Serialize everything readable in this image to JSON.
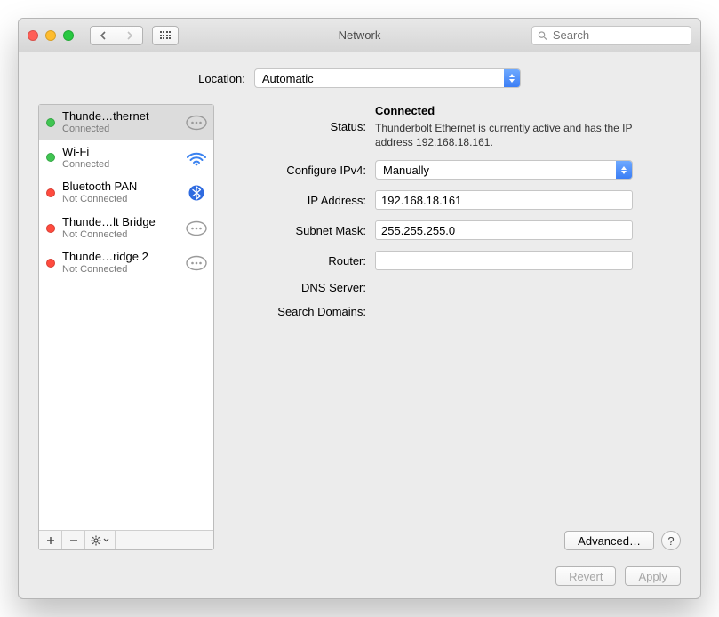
{
  "window": {
    "title": "Network",
    "search_placeholder": "Search"
  },
  "location": {
    "label": "Location:",
    "value": "Automatic"
  },
  "connections": [
    {
      "name": "Thunde…thernet",
      "status": "Connected",
      "dot": "green",
      "icon": "thunderbolt",
      "selected": true
    },
    {
      "name": "Wi-Fi",
      "status": "Connected",
      "dot": "green",
      "icon": "wifi",
      "selected": false
    },
    {
      "name": "Bluetooth PAN",
      "status": "Not Connected",
      "dot": "red",
      "icon": "bluetooth",
      "selected": false
    },
    {
      "name": "Thunde…lt Bridge",
      "status": "Not Connected",
      "dot": "red",
      "icon": "thunderbolt",
      "selected": false
    },
    {
      "name": "Thunde…ridge 2",
      "status": "Not Connected",
      "dot": "red",
      "icon": "thunderbolt",
      "selected": false
    }
  ],
  "detail": {
    "status_label": "Status:",
    "status_value": "Connected",
    "status_desc": "Thunderbolt Ethernet is currently active and has the IP address 192.168.18.161.",
    "configure_label": "Configure IPv4:",
    "configure_value": "Manually",
    "ip_label": "IP Address:",
    "ip_value": "192.168.18.161",
    "subnet_label": "Subnet Mask:",
    "subnet_value": "255.255.255.0",
    "router_label": "Router:",
    "router_value": "",
    "dns_label": "DNS Server:",
    "search_domains_label": "Search Domains:",
    "advanced_label": "Advanced…"
  },
  "footer": {
    "revert": "Revert",
    "apply": "Apply"
  }
}
